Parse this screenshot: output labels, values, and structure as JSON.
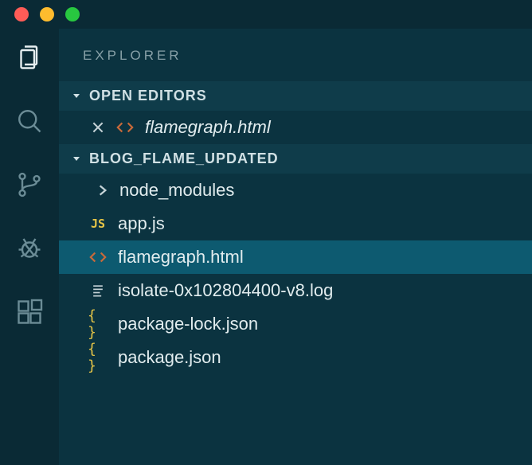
{
  "sidebar": {
    "title": "EXPLORER",
    "open_editors_label": "OPEN EDITORS",
    "open_editors": [
      {
        "name": "flamegraph.html",
        "icon": "html"
      }
    ],
    "workspace_label": "BLOG_FLAME_UPDATED",
    "files": [
      {
        "name": "node_modules",
        "type": "folder",
        "icon": "folder"
      },
      {
        "name": "app.js",
        "type": "file",
        "icon": "js"
      },
      {
        "name": "flamegraph.html",
        "type": "file",
        "icon": "html",
        "selected": true
      },
      {
        "name": "isolate-0x102804400-v8.log",
        "type": "file",
        "icon": "log"
      },
      {
        "name": "package-lock.json",
        "type": "file",
        "icon": "json"
      },
      {
        "name": "package.json",
        "type": "file",
        "icon": "json"
      }
    ]
  },
  "activitybar": {
    "items": [
      {
        "id": "explorer",
        "active": true
      },
      {
        "id": "search",
        "active": false
      },
      {
        "id": "scm",
        "active": false
      },
      {
        "id": "debug",
        "active": false
      },
      {
        "id": "extensions",
        "active": false
      }
    ]
  }
}
